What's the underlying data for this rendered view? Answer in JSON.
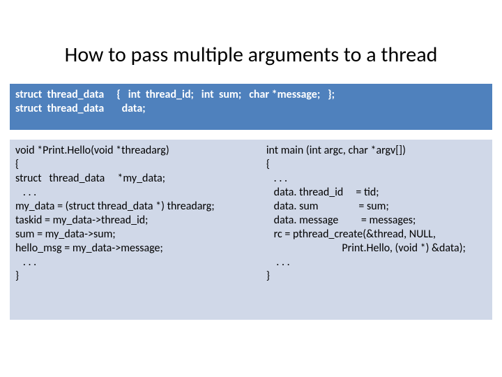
{
  "title": "How to pass multiple arguments to a thread",
  "top": "struct  thread_data     {   int  thread_id;   int  sum;   char *message;   };\nstruct  thread_data       data;",
  "left": "void *Print.Hello(void *threadarg)\n{\nstruct   thread_data     *my_data;\n   . . .\nmy_data = (struct thread_data *) threadarg;\ntaskid = my_data->thread_id;\nsum = my_data->sum;\nhello_msg = my_data->message;\n   . . .\n}",
  "right": "int main (int argc, char *argv[])\n{\n   . . .\n   data. thread_id     = tid;\n   data. sum                = sum;\n   data. message         = messages;\n   rc = pthread_create(&thread, NULL,\n                              Print.Hello, (void *) &data);\n    . . .\n}"
}
